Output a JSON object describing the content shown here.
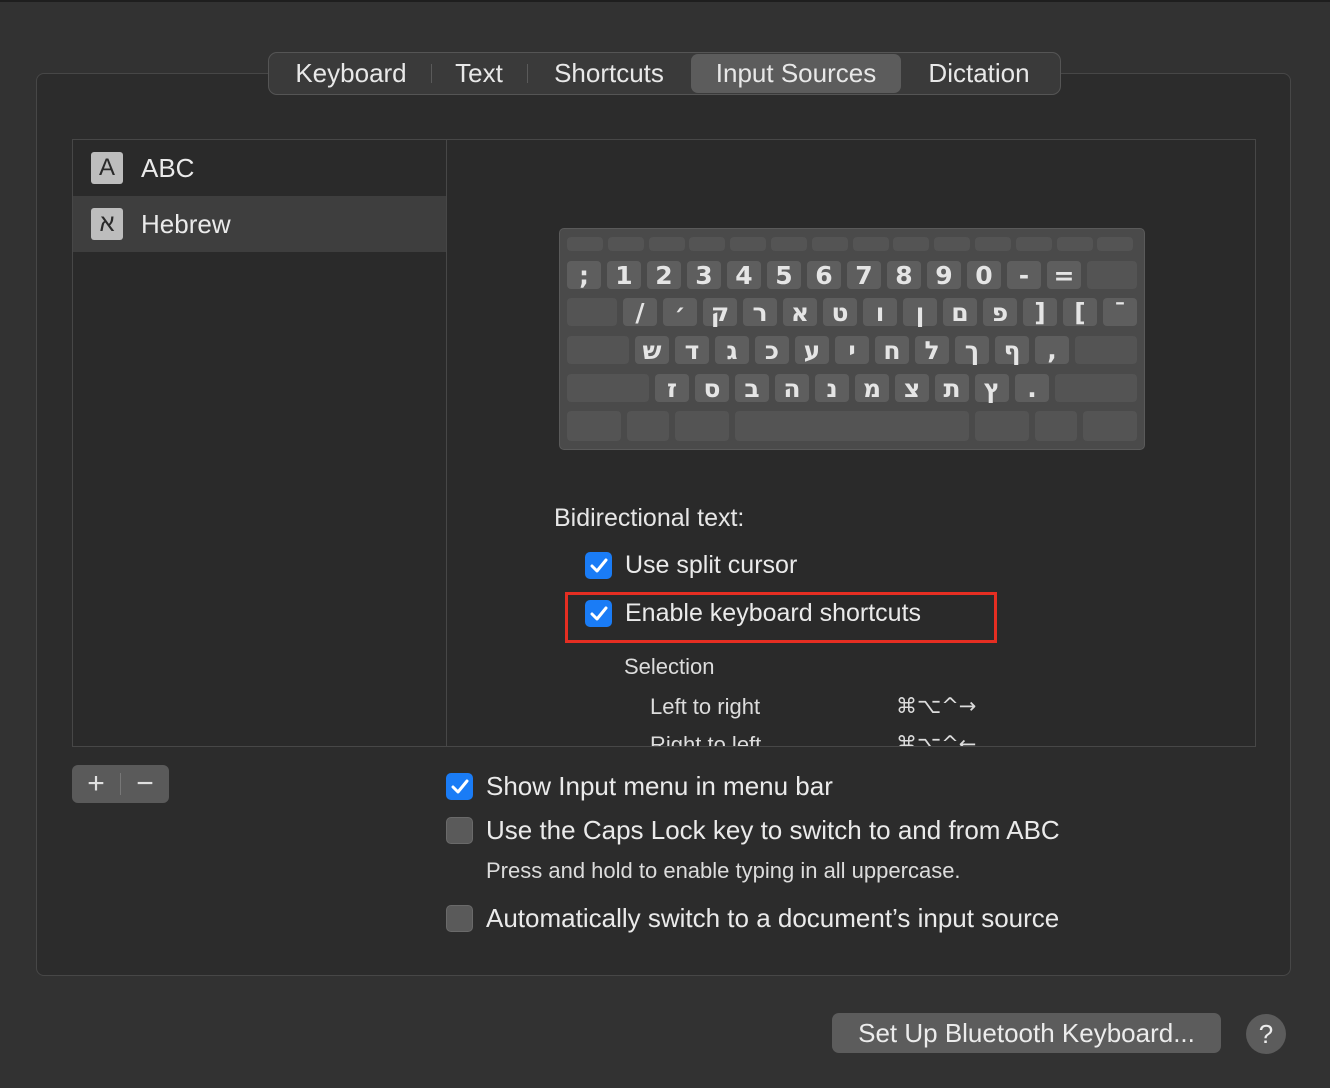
{
  "tabs": [
    {
      "label": "Keyboard"
    },
    {
      "label": "Text"
    },
    {
      "label": "Shortcuts"
    },
    {
      "label": "Input Sources",
      "selected": true
    },
    {
      "label": "Dictation"
    }
  ],
  "sources": [
    {
      "icon_glyph": "A",
      "name": "ABC"
    },
    {
      "icon_glyph": "א",
      "name": "Hebrew",
      "selected": true
    }
  ],
  "keyboard": {
    "row1": [
      ";",
      "1",
      "2",
      "3",
      "4",
      "5",
      "6",
      "7",
      "8",
      "9",
      "0",
      "-",
      "="
    ],
    "row2": [
      "/",
      "׳",
      "ק",
      "ר",
      "א",
      "ט",
      "ו",
      "ן",
      "ם",
      "פ",
      "]",
      "[",
      "ˉ"
    ],
    "row3": [
      "ש",
      "ד",
      "ג",
      "כ",
      "ע",
      "י",
      "ח",
      "ל",
      "ך",
      "ף",
      ","
    ],
    "row4": [
      "ז",
      "ס",
      "ב",
      "ה",
      "נ",
      "מ",
      "צ",
      "ת",
      "ץ",
      "."
    ]
  },
  "bidi": {
    "label": "Bidirectional text:",
    "split_cursor": {
      "label": "Use split cursor",
      "checked": true
    },
    "shortcuts": {
      "label": "Enable keyboard shortcuts",
      "checked": true
    },
    "selection_label": "Selection",
    "rows": [
      {
        "label": "Left to right",
        "keys": "⌘⌥^→"
      },
      {
        "label": "Right to left",
        "keys": "⌘⌥^←"
      }
    ]
  },
  "options": {
    "show_menu": {
      "label": "Show Input menu in menu bar",
      "checked": true
    },
    "caps_lock": {
      "label": "Use the Caps Lock key to switch to and from ABC",
      "checked": false
    },
    "caps_hint": "Press and hold to enable typing in all uppercase.",
    "auto_switch": {
      "label": "Automatically switch to a document’s input source",
      "checked": false
    }
  },
  "buttons": {
    "add": "+",
    "remove": "−",
    "bluetooth": "Set Up Bluetooth Keyboard...",
    "help": "?"
  },
  "colors": {
    "accent": "#1a7cf6",
    "highlight": "#e52e22",
    "background": "#323232"
  }
}
